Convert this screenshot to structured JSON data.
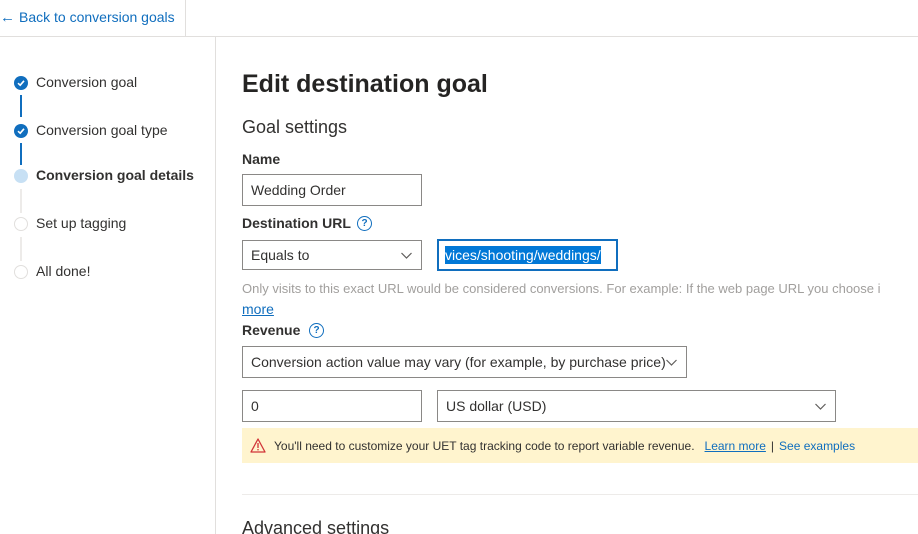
{
  "header": {
    "back_label": "Back to conversion goals"
  },
  "steps": [
    {
      "label": "Conversion goal",
      "state": "done"
    },
    {
      "label": "Conversion goal type",
      "state": "done"
    },
    {
      "label": "Conversion goal details",
      "state": "current"
    },
    {
      "label": "Set up tagging",
      "state": "todo"
    },
    {
      "label": "All done!",
      "state": "todo"
    }
  ],
  "main": {
    "title": "Edit destination goal",
    "section_title": "Goal settings",
    "name": {
      "label": "Name",
      "value": "Wedding Order"
    },
    "destination_url": {
      "label": "Destination URL",
      "help_icon": "?",
      "operator": "Equals to",
      "value_visible": "vices/shooting/weddings/",
      "hint": "Only visits to this exact URL would be considered conversions. For example: If the web page URL you choose i",
      "more_label": "more"
    },
    "revenue": {
      "label": "Revenue",
      "help_icon": "?",
      "type": "Conversion action value may vary (for example, by purchase price)",
      "amount": "0",
      "currency": "US dollar (USD)"
    },
    "warning": {
      "text": "You'll need to customize your UET tag tracking code to report variable revenue.",
      "learn_more": "Learn more",
      "separator": "|",
      "see_examples": "See examples"
    },
    "advanced_title": "Advanced settings"
  },
  "colors": {
    "accent": "#106ebe",
    "warning_bg": "#fff4ce",
    "warning_icon": "#d13438",
    "selection": "#0078d7"
  }
}
